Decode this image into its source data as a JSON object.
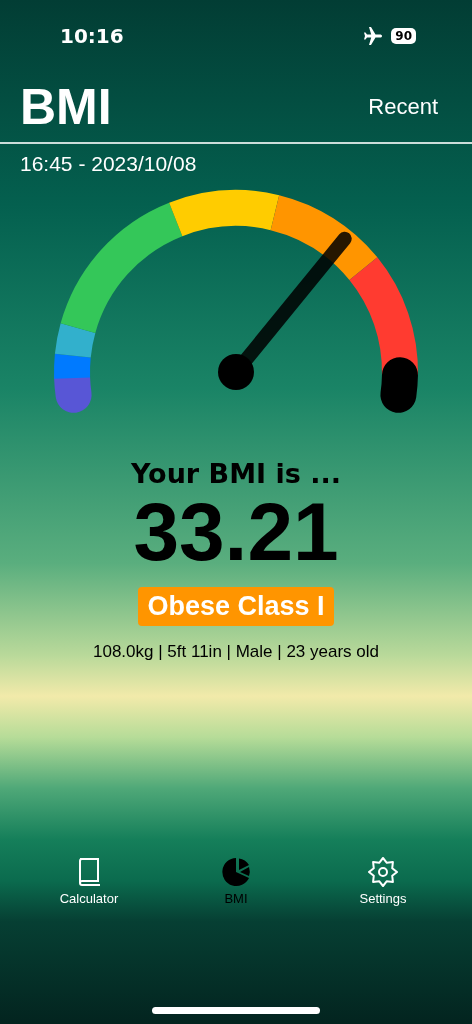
{
  "status_bar": {
    "time": "10:16",
    "battery": "90"
  },
  "header": {
    "title": "BMI",
    "action": "Recent"
  },
  "timestamp": "16:45 - 2023/10/08",
  "gauge": {
    "level": 0.7,
    "zones": [
      {
        "color": "#5856d6"
      },
      {
        "color": "#007aff"
      },
      {
        "color": "#32b0cc"
      },
      {
        "color": "#34c759"
      },
      {
        "color": "#ffcc00"
      },
      {
        "color": "#ff9500"
      },
      {
        "color": "#ff3b30"
      },
      {
        "color": "#000000"
      }
    ]
  },
  "result": {
    "heading": "Your BMI is ...",
    "value": "33.21",
    "category": "Obese Class I",
    "details": "108.0kg | 5ft 11in | Male | 23 years old"
  },
  "tab_bar": [
    {
      "label": "Calculator",
      "kind": "book",
      "selected": false
    },
    {
      "label": "BMI",
      "kind": "pie",
      "selected": true
    },
    {
      "label": "Settings",
      "kind": "gear",
      "selected": false
    }
  ]
}
